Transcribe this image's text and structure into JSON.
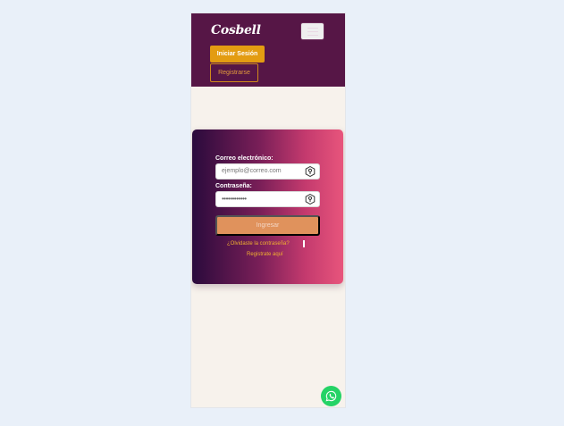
{
  "navbar": {
    "brand": "Cosbell",
    "menu_icon": "hamburger-menu-icon",
    "login_label": "Iniciar Sesión",
    "register_label": "Registrarse"
  },
  "login_form": {
    "email_label": "Correo electrónico:",
    "email_placeholder": "ejemplo@correo.com",
    "email_icon": "autofill-key-icon",
    "password_label": "Contraseña:",
    "password_value": "••••••••••••",
    "password_icon": "autofill-key-icon",
    "submit_label": "Ingresar",
    "forgot_link": "¿Olvidaste la contraseña?",
    "register_link": "Registrate aquí"
  },
  "floating": {
    "whatsapp_icon": "whatsapp-icon"
  },
  "colors": {
    "navbar_bg": "#561646",
    "accent": "#e39c12",
    "card_gradient_start": "#2a0a3c",
    "card_gradient_end": "#e8557c",
    "page_bg": "#f7f2ec",
    "whatsapp": "#25d366"
  }
}
